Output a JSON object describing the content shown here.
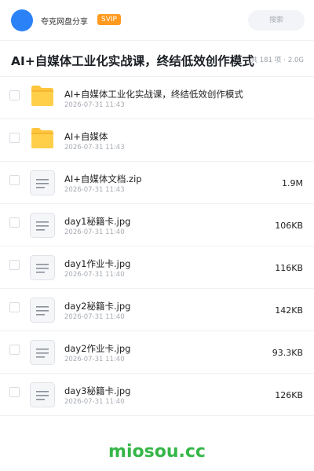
{
  "header": {
    "site_name": "夸克网盘分享",
    "svip_label": "SVIP",
    "search_placeholder": "搜索"
  },
  "title_bar": {
    "title": "AI+自媒体工业化实战课，终结低效创作模式",
    "item_count": "共 181 项",
    "total_size": "2.0G"
  },
  "files": [
    {
      "type": "folder",
      "icon": "folder-icon",
      "name": "AI+自媒体工业化实战课，终结低效创作模式",
      "date": "2026-07-31 11:43",
      "size": ""
    },
    {
      "type": "folder",
      "icon": "folder-icon",
      "name": "AI+自媒体",
      "date": "2026-07-31 11:43",
      "size": ""
    },
    {
      "type": "file",
      "icon": "document-icon",
      "name": "AI+自媒体文档.zip",
      "date": "2026-07-31 11:43",
      "size": "1.9M"
    },
    {
      "type": "file",
      "icon": "document-icon",
      "name": "day1秘籍卡.jpg",
      "date": "2026-07-31 11:40",
      "size": "106KB"
    },
    {
      "type": "file",
      "icon": "document-icon",
      "name": "day1作业卡.jpg",
      "date": "2026-07-31 11:40",
      "size": "116KB"
    },
    {
      "type": "file",
      "icon": "document-icon",
      "name": "day2秘籍卡.jpg",
      "date": "2026-07-31 11:40",
      "size": "142KB"
    },
    {
      "type": "file",
      "icon": "document-icon",
      "name": "day2作业卡.jpg",
      "date": "2026-07-31 11:40",
      "size": "93.3KB"
    },
    {
      "type": "file",
      "icon": "document-icon",
      "name": "day3秘籍卡.jpg",
      "date": "2026-07-31 11:40",
      "size": "126KB"
    }
  ],
  "watermark": "miosou.cc",
  "colors": {
    "accent": "#2a82f6",
    "svip": "#ff9a1f",
    "folder": "#ffc53d",
    "watermark": "#35b648"
  }
}
